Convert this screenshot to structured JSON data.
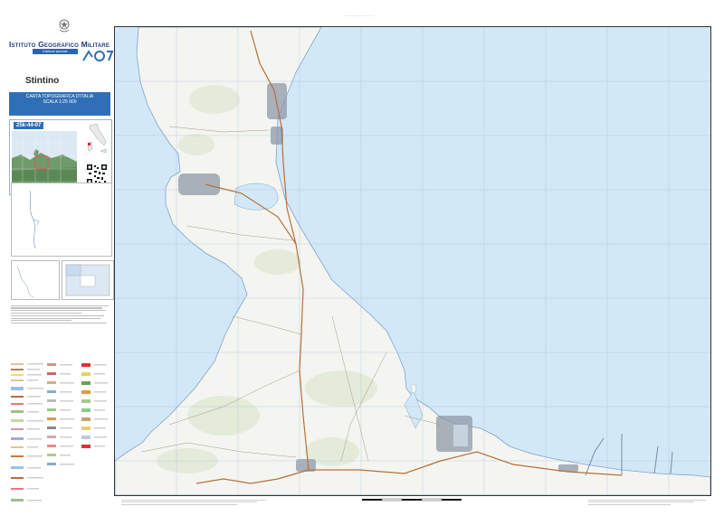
{
  "header": {
    "institute": "Istituto Geografico Militare",
    "edition": "Edizione speciale",
    "sheet_name": "Stintino",
    "title_line1": "CARTA TOPOGRAFICA D'ITALIA",
    "title_line2": "SCALA 1:25 000",
    "sheet_code": "25k-44-07"
  },
  "colors": {
    "sea": "#d3e8f7",
    "land": "#f4f5f0",
    "road_main": "#b5703c",
    "grid": "#9fb9d6",
    "brand_blue": "#2f6fb8",
    "urban": "#8f98a8"
  },
  "icons": [
    "ministry-emblem-icon",
    "anniversary-150-logo-icon",
    "qr-code-icon",
    "italy-locator-icon"
  ]
}
